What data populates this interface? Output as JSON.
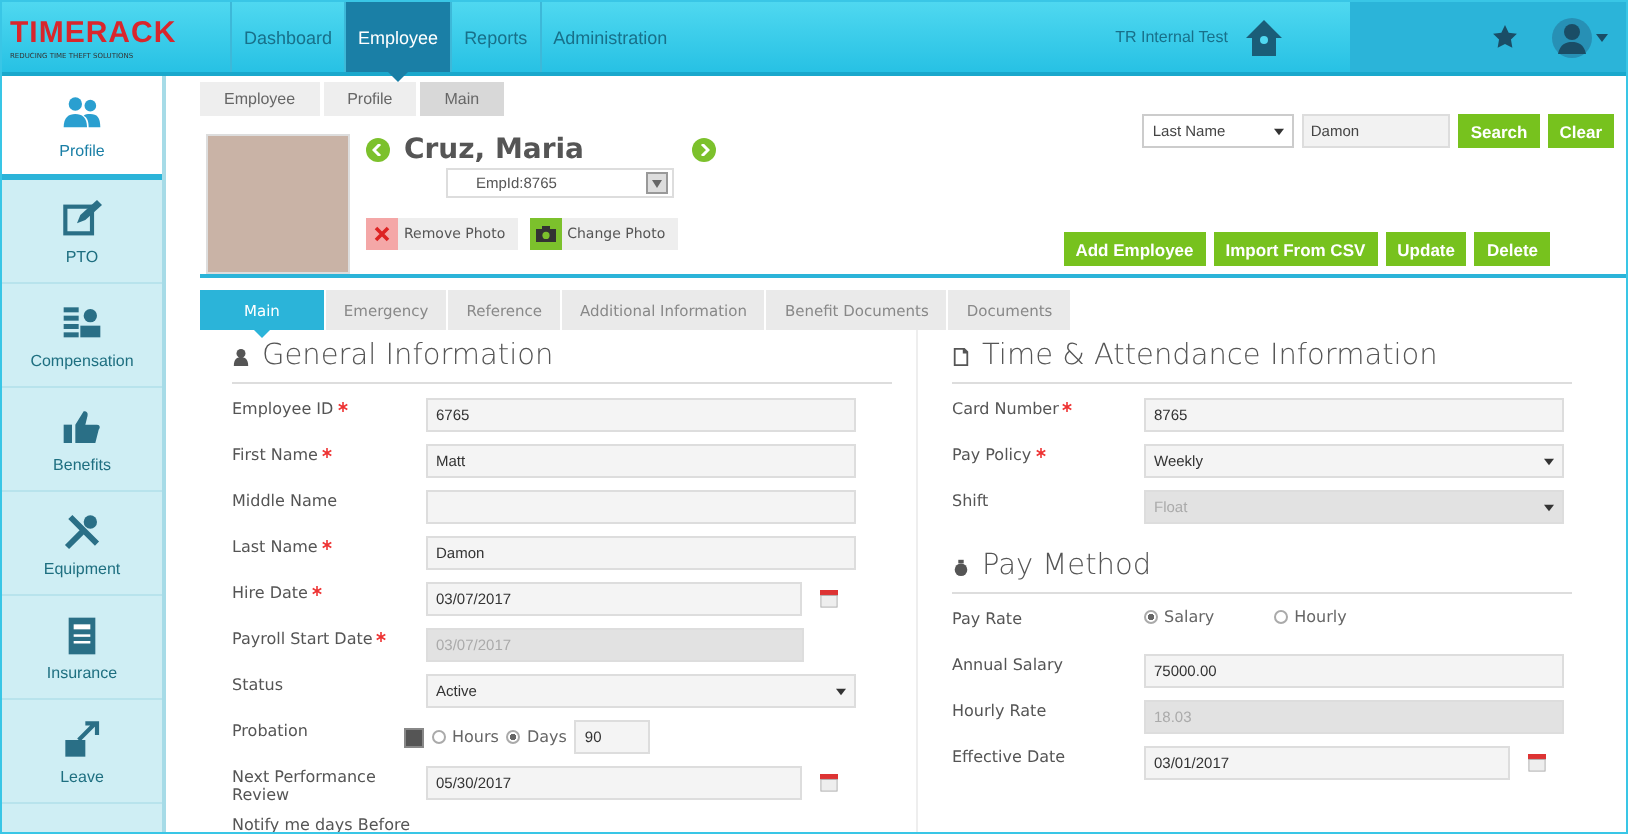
{
  "brand": {
    "name": "TIMERACK",
    "tagline": "REDUCING TIME THEFT SOLUTIONS"
  },
  "top_nav": [
    {
      "label": "Dashboard",
      "selected": false
    },
    {
      "label": "Employee",
      "selected": true
    },
    {
      "label": "Reports",
      "selected": false
    },
    {
      "label": "Administration",
      "selected": false
    }
  ],
  "org_name": "TR Internal Test",
  "sidebar": {
    "items": [
      {
        "label": "Profile",
        "selected": true
      },
      {
        "label": "PTO",
        "selected": false
      },
      {
        "label": "Compensation",
        "selected": false
      },
      {
        "label": "Benefits",
        "selected": false
      },
      {
        "label": "Equipment",
        "selected": false
      },
      {
        "label": "Insurance",
        "selected": false
      },
      {
        "label": "Leave",
        "selected": false
      }
    ]
  },
  "breadcrumb": [
    "Employee",
    "Profile",
    "Main"
  ],
  "employee": {
    "name": "Cruz, Maria",
    "emp_id": "EmpId:8765"
  },
  "photo_buttons": [
    {
      "label": "Remove Photo",
      "kind": "remove"
    },
    {
      "label": "Change Photo",
      "kind": "change"
    }
  ],
  "search": {
    "field": "Last Name",
    "value": "Damon",
    "buttons": [
      "Search",
      "Clear"
    ]
  },
  "actions": [
    "Add Employee",
    "Import From CSV",
    "Update",
    "Delete"
  ],
  "tabs": [
    {
      "label": "Main",
      "selected": true
    },
    {
      "label": "Emergency",
      "selected": false
    },
    {
      "label": "Reference",
      "selected": false
    },
    {
      "label": "Additional Information",
      "selected": false
    },
    {
      "label": "Benefit Documents",
      "selected": false
    },
    {
      "label": "Documents",
      "selected": false
    }
  ],
  "general": {
    "title": "General Information",
    "rows": [
      {
        "label": "Employee ID",
        "required": true,
        "kind": "text",
        "value": "6765",
        "disabled": false
      },
      {
        "label": "First Name",
        "required": true,
        "kind": "text",
        "value": "Matt",
        "disabled": false
      },
      {
        "label": "Middle Name",
        "required": false,
        "kind": "text",
        "disabled": false
      },
      {
        "label": "Last Name",
        "required": true,
        "kind": "text",
        "value": "Damon",
        "disabled": false
      },
      {
        "label": "Hire Date",
        "required": true,
        "kind": "date",
        "value": "03/07/2017",
        "disabled": false
      },
      {
        "label": "Payroll Start Date",
        "required": true,
        "kind": "text",
        "value": "03/07/2017",
        "disabled": true,
        "short": true
      },
      {
        "label": "Status",
        "required": false,
        "kind": "select",
        "value": "Active",
        "disabled": false
      },
      {
        "label": "Probation",
        "required": false,
        "kind": "probation",
        "checked": true,
        "options": [
          {
            "label": "Hours",
            "selected": false
          },
          {
            "label": "Days",
            "selected": true
          }
        ],
        "value": "90"
      },
      {
        "label": "Next Performance Review",
        "required": false,
        "kind": "date",
        "value": "05/30/2017",
        "disabled": false
      },
      {
        "label": "Notify me days Before",
        "required": false,
        "kind": "label"
      }
    ]
  },
  "time_attendance": {
    "title": "Time & Attendance Information",
    "rows": [
      {
        "label": "Card Number",
        "required": true,
        "kind": "text",
        "value": "8765",
        "disabled": false
      },
      {
        "label": "Pay Policy",
        "required": true,
        "kind": "select",
        "value": "Weekly",
        "disabled": false
      },
      {
        "label": "Shift",
        "required": false,
        "kind": "select",
        "value": "Float",
        "disabled": true
      }
    ]
  },
  "pay_method": {
    "title": "Pay Method",
    "rows": [
      {
        "label": "Pay Rate",
        "required": false,
        "kind": "radio",
        "options": [
          {
            "label": "Salary",
            "selected": true
          },
          {
            "label": "Hourly",
            "selected": false
          }
        ]
      },
      {
        "label": "Annual Salary",
        "required": false,
        "kind": "text",
        "value": "75000.00",
        "disabled": false
      },
      {
        "label": "Hourly Rate",
        "required": false,
        "kind": "text",
        "value": "18.03",
        "disabled": true
      },
      {
        "label": "Effective Date",
        "required": false,
        "kind": "date",
        "value": "03/01/2017",
        "disabled": false
      }
    ]
  }
}
